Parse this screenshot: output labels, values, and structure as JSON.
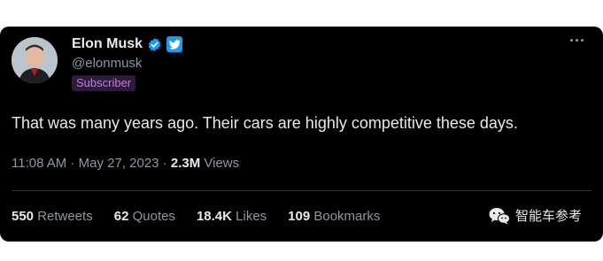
{
  "user": {
    "name": "Elon Musk",
    "handle": "@elonmusk",
    "badge": "Subscriber",
    "verified_color": "#1d9bf0"
  },
  "tweet": {
    "text": "That was many years ago. Their cars are highly competitive these days."
  },
  "meta": {
    "time": "11:08 AM",
    "separator": " · ",
    "date": "May 27, 2023",
    "views_count": "2.3M",
    "views_label": " Views"
  },
  "stats": {
    "retweets": {
      "num": "550",
      "label": " Retweets"
    },
    "quotes": {
      "num": "62",
      "label": " Quotes"
    },
    "likes": {
      "num": "18.4K",
      "label": " Likes"
    },
    "bookmarks": {
      "num": "109",
      "label": " Bookmarks"
    }
  },
  "watermark": {
    "text": "智能车参考",
    "icon": "wechat-icon"
  },
  "icons": {
    "more": "more-options-icon",
    "verified": "verified-badge-icon",
    "platform": "twitter-bird-icon"
  },
  "colors": {
    "background": "#000000",
    "text": "#e7e9ea",
    "muted": "#8b98a5",
    "accent": "#1d9bf0",
    "subscriber": "#c17bea"
  }
}
